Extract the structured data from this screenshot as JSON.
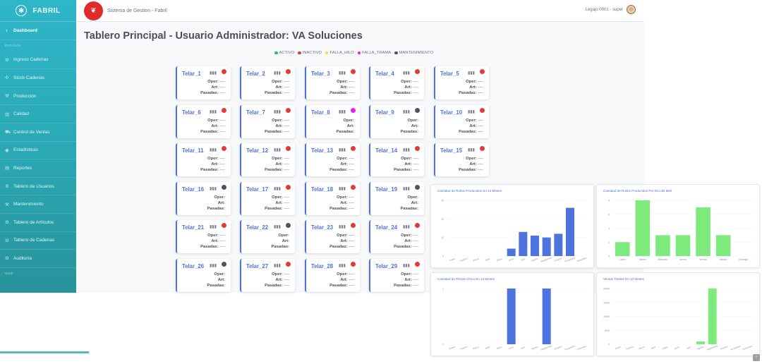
{
  "brand": {
    "name": "FABRIL",
    "icon": "gear-logo-icon"
  },
  "header": {
    "system_title": "Sistema de Gestion - Fabril",
    "user": "Legajo 0001 - super"
  },
  "sidebar": {
    "items": [
      {
        "label": "Dashboard",
        "icon": "dashboard-icon",
        "active": true
      },
      {
        "section": "PAGINAS"
      },
      {
        "label": "Ingreso Cadenas",
        "icon": "gear-icon"
      },
      {
        "label": "Stock Cadenas",
        "icon": "stock-icon"
      },
      {
        "label": "Producción",
        "icon": "wrench-icon"
      },
      {
        "label": "Calidad",
        "icon": "chart-icon"
      },
      {
        "label": "Control de Ventas",
        "icon": "truck-icon"
      },
      {
        "label": "Estadísticas",
        "icon": "eye-icon"
      },
      {
        "label": "Reportes",
        "icon": "print-icon"
      },
      {
        "label": "Tablero de Usuarios",
        "icon": "gear-icon"
      },
      {
        "label": "Mantenimiento",
        "icon": "wrench-icon"
      },
      {
        "label": "Tablero de Artículos",
        "icon": "gear-icon"
      },
      {
        "label": "Tablero de Cadenas",
        "icon": "gear-icon"
      },
      {
        "label": "Auditoría",
        "icon": "gear-icon"
      },
      {
        "section": "WEB"
      }
    ]
  },
  "main": {
    "title": "Tablero Principal - Usuario Administrador: VA Soluciones",
    "legend": [
      {
        "label": "ACTIVO",
        "color": "#22c55e"
      },
      {
        "label": "INACTIVO",
        "color": "#e53935"
      },
      {
        "label": "FALLA_HILO",
        "color": "#f2e12b"
      },
      {
        "label": "FALLA_TRAMA",
        "color": "#e91ee6"
      },
      {
        "label": "MANTENIMIENTO",
        "color": "#4b5563"
      }
    ],
    "labels": {
      "oper": "Oper:",
      "art": "Art:",
      "pasadas": "Pasadas:"
    },
    "telares": [
      {
        "name": "Telar_1",
        "status": "#e53935",
        "oper": "----",
        "art": "----",
        "pasadas": "----"
      },
      {
        "name": "Telar_2",
        "status": "#e53935",
        "oper": "----",
        "art": "----",
        "pasadas": "----"
      },
      {
        "name": "Telar_3",
        "status": "#e53935",
        "oper": "----",
        "art": "----",
        "pasadas": "----"
      },
      {
        "name": "Telar_4",
        "status": "#e53935",
        "oper": "----",
        "art": "----",
        "pasadas": "----"
      },
      {
        "name": "Telar_5",
        "status": "#e53935",
        "oper": "----",
        "art": "----",
        "pasadas": "----"
      },
      {
        "name": "Telar_6",
        "status": "#e53935",
        "oper": "----",
        "art": "----",
        "pasadas": "----"
      },
      {
        "name": "Telar_7",
        "status": "#e53935",
        "oper": "----",
        "art": "----",
        "pasadas": "----"
      },
      {
        "name": "Telar_8",
        "status": "#e91ee6",
        "oper": "",
        "art": "",
        "pasadas": ""
      },
      {
        "name": "Telar_9",
        "status": "#4b5563",
        "oper": "",
        "art": "",
        "pasadas": ""
      },
      {
        "name": "Telar_10",
        "status": "#e53935",
        "oper": "----",
        "art": "----",
        "pasadas": "----"
      },
      {
        "name": "Telar_11",
        "status": "#e53935",
        "oper": "----",
        "art": "----",
        "pasadas": "----"
      },
      {
        "name": "Telar_12",
        "status": "#e53935",
        "oper": "----",
        "art": "----",
        "pasadas": "----"
      },
      {
        "name": "Telar_13",
        "status": "#e53935",
        "oper": "----",
        "art": "----",
        "pasadas": "----"
      },
      {
        "name": "Telar_14",
        "status": "#e53935",
        "oper": "----",
        "art": "----",
        "pasadas": "----"
      },
      {
        "name": "Telar_15",
        "status": "#e53935",
        "oper": "----",
        "art": "----",
        "pasadas": "----"
      },
      {
        "name": "Telar_16",
        "status": "#4b5563",
        "oper": "",
        "art": "",
        "pasadas": ""
      },
      {
        "name": "Telar_17",
        "status": "#e53935",
        "oper": "----",
        "art": "----",
        "pasadas": "----"
      },
      {
        "name": "Telar_18",
        "status": "#e53935",
        "oper": "----",
        "art": "----",
        "pasadas": "----"
      },
      {
        "name": "Telar_19",
        "status": "#4b5563",
        "oper": "",
        "art": "",
        "pasadas": ""
      },
      {
        "name": "Telar_21",
        "status": "#e53935",
        "oper": "----",
        "art": "----",
        "pasadas": "----"
      },
      {
        "name": "Telar_22",
        "status": "#4b5563",
        "oper": "",
        "art": "",
        "pasadas": ""
      },
      {
        "name": "Telar_23",
        "status": "#e53935",
        "oper": "----",
        "art": "----",
        "pasadas": "----"
      },
      {
        "name": "Telar_24",
        "status": "#e53935",
        "oper": "----",
        "art": "----",
        "pasadas": "----"
      },
      {
        "name": "Telar_26",
        "status": "#4b5563",
        "oper": "",
        "art": "",
        "pasadas": ""
      },
      {
        "name": "Telar_27",
        "status": "#e53935",
        "oper": "----",
        "art": "----",
        "pasadas": "----"
      },
      {
        "name": "Telar_28",
        "status": "#e53935",
        "oper": "----",
        "art": "----",
        "pasadas": "----"
      },
      {
        "name": "Telar_29",
        "status": "#e53935",
        "oper": "----",
        "art": "----",
        "pasadas": "----"
      }
    ]
  },
  "chart_data": [
    {
      "type": "bar",
      "title": "Cantidad de Rollos Producidos En 12 Meses",
      "color": "#4e73df",
      "categories": [
        "Enero",
        "Febrero",
        "Marzo",
        "Abril",
        "Mayo",
        "Junio",
        "Julio",
        "Agosto",
        "Septiembre",
        "Octubre",
        "Noviembre",
        "Diciembre"
      ],
      "values": [
        0,
        0,
        0,
        0,
        0,
        4,
        13,
        11,
        10,
        12,
        26,
        0
      ],
      "yticks": [
        "0",
        "10",
        "20",
        "30"
      ],
      "ylim": [
        0,
        30
      ]
    },
    {
      "type": "bar",
      "title": "Cantidad de Rollos Producidos Por Día del Mes",
      "color": "#7eea7e",
      "categories": [
        "Lunes",
        "Martes",
        "Miércoles",
        "Jueves",
        "Viernes",
        "Sábado",
        "Domingo"
      ],
      "values": [
        2,
        8,
        3,
        3,
        7,
        3,
        0
      ],
      "yticks": [
        "0",
        "2",
        "4",
        "6",
        "8"
      ],
      "ylim": [
        0,
        8
      ]
    },
    {
      "type": "bar",
      "title": "Cantidad de Piezas Chica En 12 Meses",
      "color": "#4e73df",
      "categories": [
        "Enero",
        "Febrero",
        "Marzo",
        "Abril",
        "Mayo",
        "Junio",
        "Julio",
        "Agosto",
        "Septiembre",
        "Octubre",
        "Noviembre",
        "Diciembre"
      ],
      "values": [
        0,
        0,
        0,
        0,
        0,
        1,
        0,
        0,
        1,
        0,
        0,
        0
      ],
      "yticks": [
        "0",
        "1"
      ],
      "ylim": [
        0,
        1
      ]
    },
    {
      "type": "bar",
      "title": "Ventas Totales En 12 Meses",
      "color": "#7eea7e",
      "categories": [
        "Enero",
        "Febrero",
        "Marzo",
        "Abril",
        "Mayo",
        "Junio",
        "Julio",
        "Agosto",
        "Septiembre",
        "Octubre",
        "Noviembre",
        "Diciembre"
      ],
      "values": [
        0,
        0,
        0,
        0,
        0,
        0,
        0,
        1000,
        20000,
        0,
        0,
        0
      ],
      "yticks": [
        "0",
        "5000",
        "10000",
        "15000",
        "20000"
      ],
      "ylim": [
        0,
        20000
      ]
    }
  ]
}
